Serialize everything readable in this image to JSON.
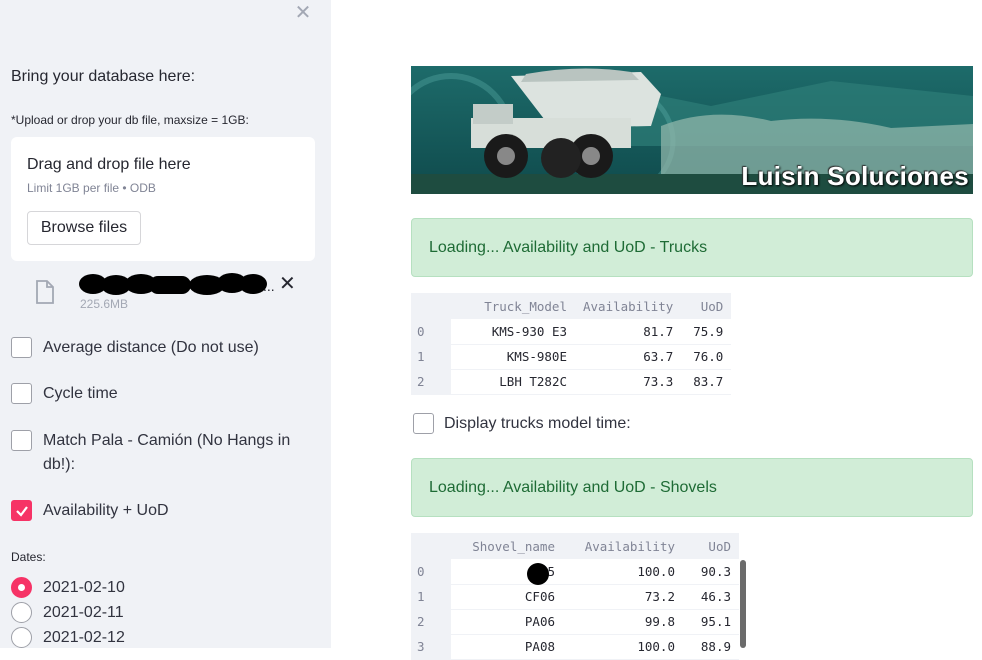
{
  "sidebar": {
    "close_icon": "close-icon",
    "heading": "Bring your database here:",
    "upload_label": "*Upload or drop your db file, maxsize = 1GB:",
    "dropzone": {
      "title": "Drag and drop file here",
      "limit": "Limit 1GB per file • ODB",
      "browse_label": "Browse files"
    },
    "file": {
      "icon": "file-icon",
      "name_suffix": "...",
      "size": "225.6MB",
      "remove_icon": "close-icon"
    },
    "checkboxes": [
      {
        "label": "Average distance (Do not use)",
        "checked": false
      },
      {
        "label": "Cycle time",
        "checked": false
      },
      {
        "label": "Match Pala - Camión (No Hangs in db!):",
        "checked": false
      },
      {
        "label": "Availability + UoD",
        "checked": true
      }
    ],
    "dates_label": "Dates:",
    "dates": [
      {
        "label": "2021-02-10",
        "selected": true
      },
      {
        "label": "2021-02-11",
        "selected": false
      },
      {
        "label": "2021-02-12",
        "selected": false
      }
    ]
  },
  "main": {
    "banner_text": "Luisin Soluciones",
    "alert_trucks": "Loading... Availability and UoD - Trucks",
    "trucks_table": {
      "columns": [
        "Truck_Model",
        "Availability",
        "UoD"
      ],
      "rows": [
        [
          "0",
          "KMS-930 E3",
          "81.7",
          "75.9"
        ],
        [
          "1",
          "KMS-980E",
          "63.7",
          "76.0"
        ],
        [
          "2",
          "LBH T282C",
          "73.3",
          "83.7"
        ]
      ]
    },
    "display_trucks_label": "Display trucks model time:",
    "alert_shovels": "Loading... Availability and UoD - Shovels",
    "shovels_table": {
      "columns": [
        "Shovel_name",
        "Availability",
        "UoD"
      ],
      "rows": [
        [
          "0",
          "C 5",
          "100.0",
          "90.3"
        ],
        [
          "1",
          "CF06",
          "73.2",
          "46.3"
        ],
        [
          "2",
          "PA06",
          "99.8",
          "95.1"
        ],
        [
          "3",
          "PA08",
          "100.0",
          "88.9"
        ]
      ]
    }
  },
  "colors": {
    "accent": "#f63366",
    "sidebar_bg": "#f0f2f6",
    "alert_bg": "#d1edd7",
    "alert_text": "#1e6b35"
  }
}
